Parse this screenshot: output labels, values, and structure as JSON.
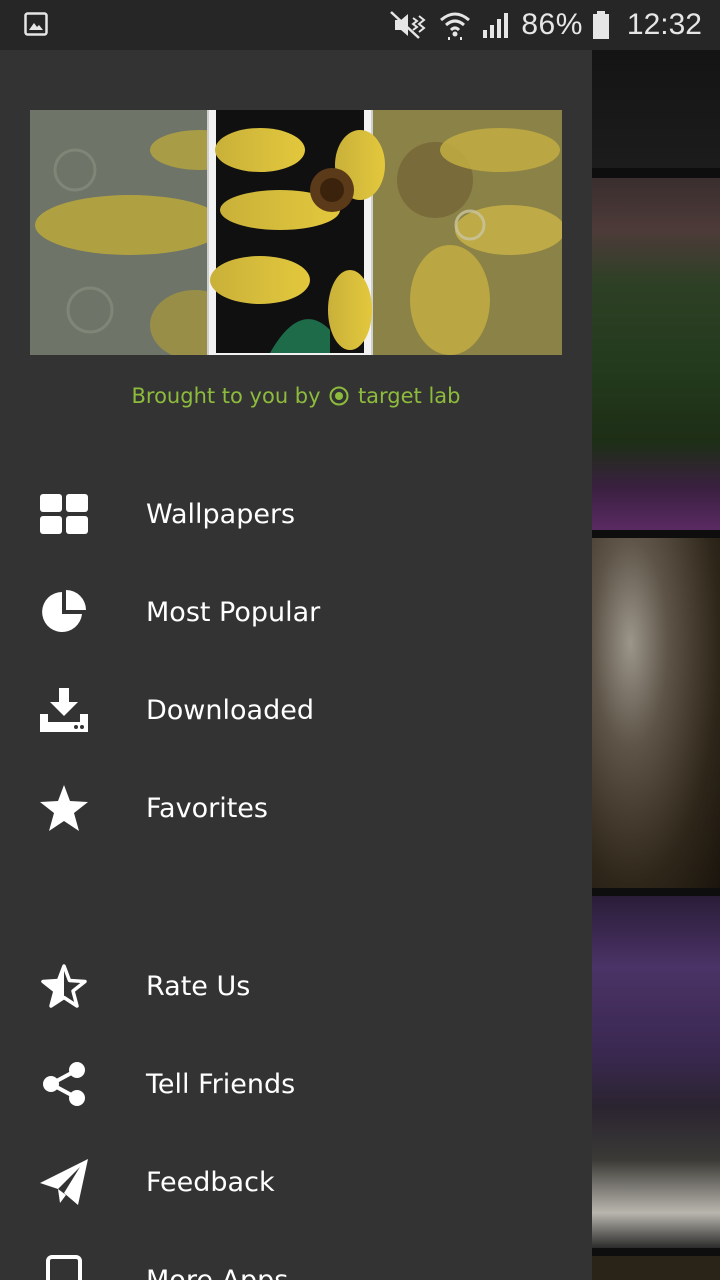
{
  "status_bar": {
    "battery_percent": "86%",
    "time": "12:32"
  },
  "drawer": {
    "credit_prefix": "Brought to you by",
    "credit_brand": "target lab",
    "primary_items": [
      {
        "label": "Wallpapers",
        "icon": "grid-icon"
      },
      {
        "label": "Most Popular",
        "icon": "pie-chart-icon"
      },
      {
        "label": "Downloaded",
        "icon": "download-icon"
      },
      {
        "label": "Favorites",
        "icon": "star-icon"
      }
    ],
    "secondary_items": [
      {
        "label": "Rate Us",
        "icon": "half-star-icon"
      },
      {
        "label": "Tell Friends",
        "icon": "share-icon"
      },
      {
        "label": "Feedback",
        "icon": "send-icon"
      },
      {
        "label": "More Apps",
        "icon": "phone-icon"
      }
    ]
  },
  "colors": {
    "drawer_bg": "#333333",
    "accent_green": "#8dbb3c",
    "status_bar_bg": "#262626"
  }
}
